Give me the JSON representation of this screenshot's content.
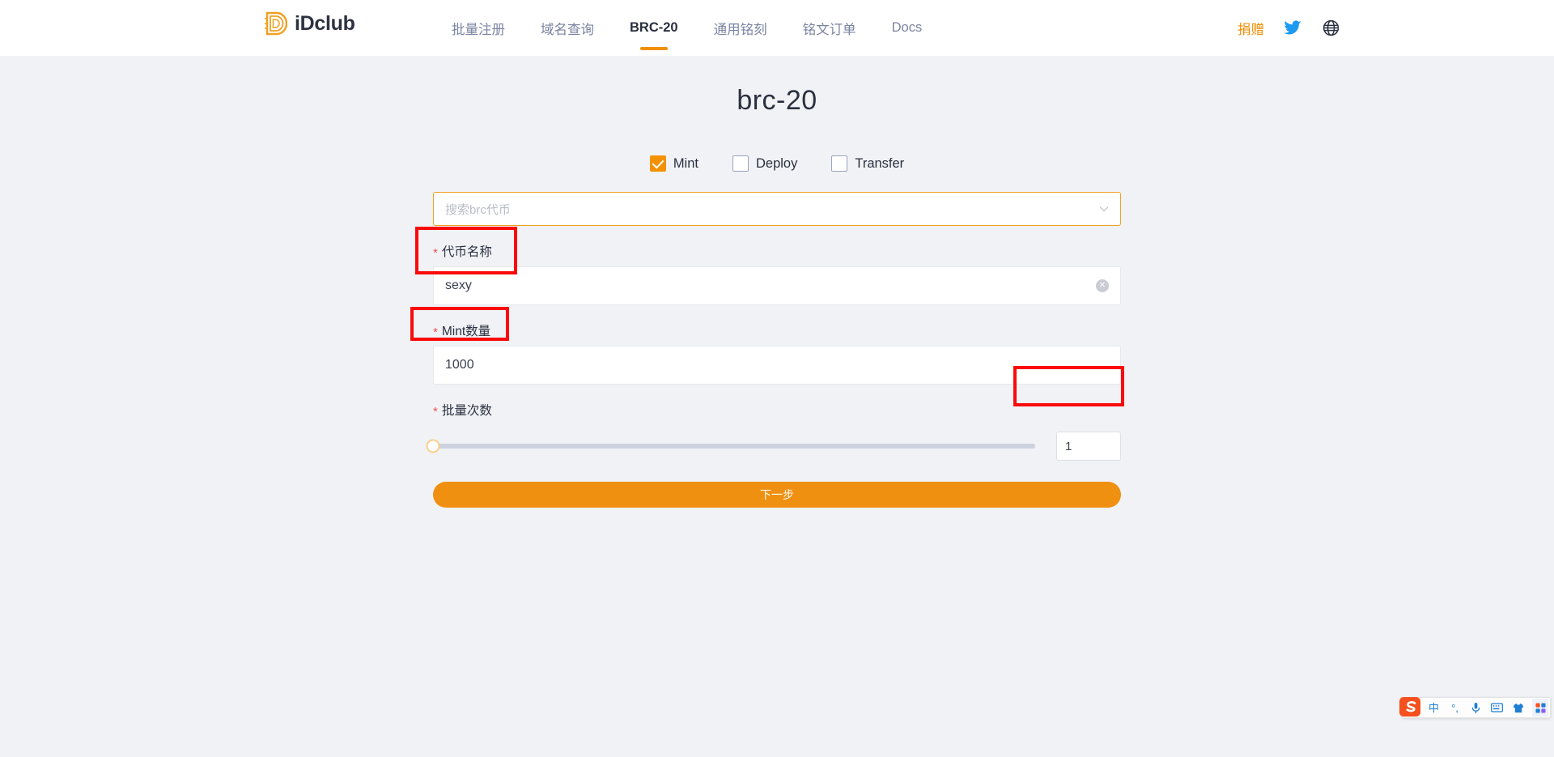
{
  "header": {
    "brand": {
      "name": "iDclub",
      "logo_icon": "idclub-logo-icon",
      "accent": "#f0a020"
    },
    "nav": [
      {
        "label": "批量注册",
        "active": false
      },
      {
        "label": "域名查询",
        "active": false
      },
      {
        "label": "BRC-20",
        "active": true
      },
      {
        "label": "通用铭刻",
        "active": false
      },
      {
        "label": "铭文订单",
        "active": false
      },
      {
        "label": "Docs",
        "active": false
      }
    ],
    "donate_label": "捐赠",
    "twitter_icon": "twitter-bird-icon",
    "language_icon": "globe-icon"
  },
  "main": {
    "title": "brc-20",
    "operations": [
      {
        "label": "Mint",
        "checked": true
      },
      {
        "label": "Deploy",
        "checked": false
      },
      {
        "label": "Transfer",
        "checked": false
      }
    ],
    "token_search": {
      "placeholder": "搜索brc代币",
      "value": "",
      "chevron_icon": "chevron-down-icon"
    },
    "fields": [
      {
        "label": "代币名称",
        "required_mark": "*",
        "value": "sexy",
        "clear_icon": "clear-circle-icon"
      },
      {
        "label": "Mint数量",
        "required_mark": "*",
        "value": "1000"
      }
    ],
    "batch": {
      "label": "批量次数",
      "required_mark": "*",
      "value": "1",
      "slider_percent": 0
    },
    "submit_label": "下一步"
  },
  "annotations": [
    {
      "name": "token-name-highlight",
      "color": "#fa0a0a"
    },
    {
      "name": "mint-amount-highlight",
      "color": "#fa0a0a"
    },
    {
      "name": "batch-count-highlight",
      "color": "#fa0a0a"
    }
  ],
  "ime": {
    "logo_icon": "sogou-logo-icon",
    "items": [
      {
        "icon": "chinese-mode-icon",
        "glyph": "中"
      },
      {
        "icon": "punctuation-mode-icon",
        "glyph": "°,"
      },
      {
        "icon": "microphone-icon",
        "glyph": ""
      },
      {
        "icon": "soft-keyboard-icon",
        "glyph": ""
      },
      {
        "icon": "skin-shirt-icon",
        "glyph": ""
      },
      {
        "icon": "apps-grid-icon",
        "glyph": ""
      }
    ]
  }
}
